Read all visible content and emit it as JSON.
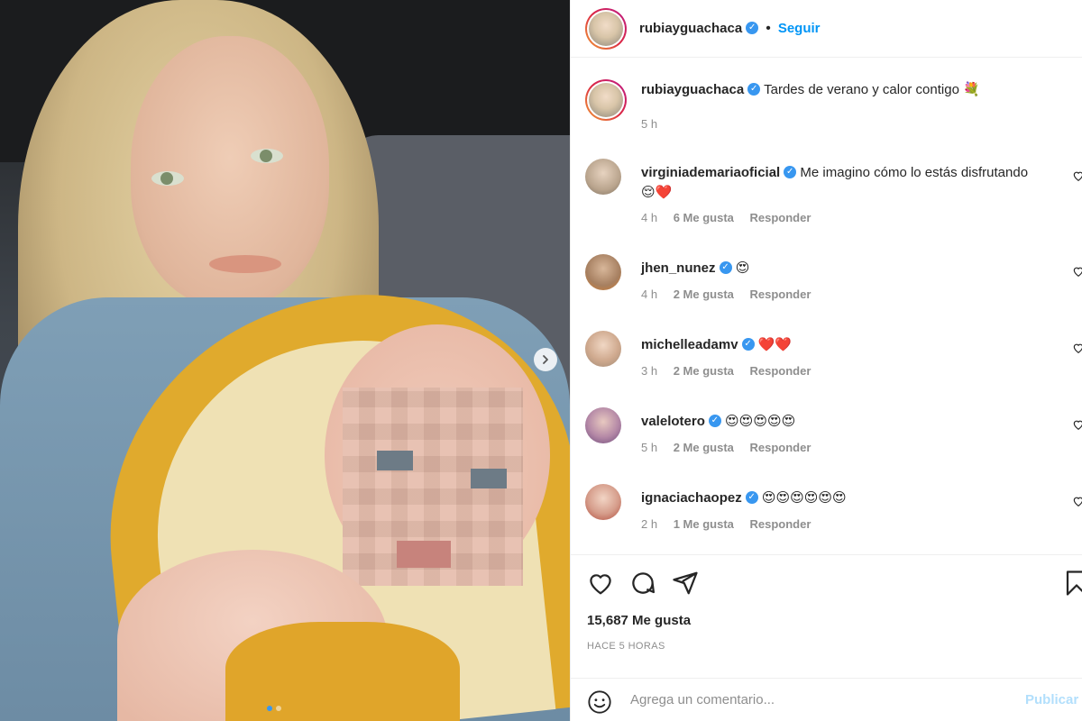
{
  "post": {
    "username": "rubiayguachaca",
    "follow_label": "Seguir",
    "separator": "•",
    "caption_user": "rubiayguachaca",
    "caption_text": "Tardes de verano y calor contigo",
    "caption_emoji": "💐",
    "caption_time": "5 h"
  },
  "comments": [
    {
      "user": "virginiademariaoficial",
      "verified": true,
      "text": "Me imagino cómo lo estás disfrutando 😌❤️",
      "time": "4 h",
      "likes": "6 Me gusta",
      "reply": "Responder"
    },
    {
      "user": "jhen_nunez",
      "verified": true,
      "text": "😍",
      "time": "4 h",
      "likes": "2 Me gusta",
      "reply": "Responder"
    },
    {
      "user": "michelleadamv",
      "verified": true,
      "text": "❤️❤️",
      "time": "3 h",
      "likes": "2 Me gusta",
      "reply": "Responder"
    },
    {
      "user": "valelotero",
      "verified": true,
      "text": "😍😍😍😍😍",
      "time": "5 h",
      "likes": "2 Me gusta",
      "reply": "Responder"
    },
    {
      "user": "ignaciachaopez",
      "verified": true,
      "text": "😍😍😍😍😍😍",
      "time": "2 h",
      "likes": "1 Me gusta",
      "reply": "Responder"
    }
  ],
  "stats": {
    "likes": "15,687 Me gusta",
    "ago": "HACE 5 HORAS"
  },
  "composer": {
    "placeholder": "Agrega un comentario...",
    "publish": "Publicar"
  },
  "icons": {
    "verified": "verified-badge-icon",
    "like": "heart-icon",
    "comment": "comment-bubble-icon",
    "share": "paper-plane-icon",
    "save": "bookmark-icon",
    "emoji": "smiley-icon",
    "next": "chevron-right-icon"
  },
  "colors": {
    "accent": "#0095f6",
    "verified": "#3897f0",
    "muted": "#8e8e8e",
    "publish_disabled": "#b2dffc"
  },
  "carousel": {
    "slides": 2,
    "active": 1
  }
}
